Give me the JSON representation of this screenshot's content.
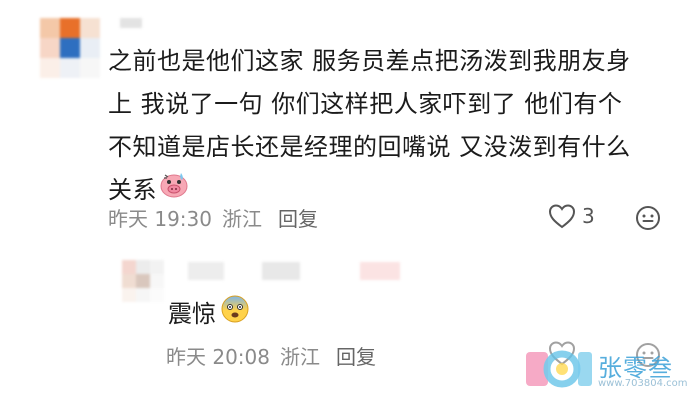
{
  "comment": {
    "text_lines": [
      "之前也是他们这家 服务员差点把汤泼到我朋友身",
      "上 我说了一句 你们这样把人家吓到了 他们有个",
      "不知道是店长还是经理的回嘴说 又没泼到有什么",
      "关系"
    ],
    "emoji": "pig-sweat-emoji",
    "time": "昨天 19:30",
    "location": "浙江",
    "reply_label": "回复",
    "like_count": "3",
    "like_icon": "heart-outline-icon",
    "more_icon": "emoji-face-icon"
  },
  "reply": {
    "text": "震惊",
    "emoji": "shocked-face-emoji",
    "time": "昨天 20:08",
    "location": "浙江",
    "reply_label": "回复"
  },
  "watermark": {
    "name": "张零叁",
    "url": "www.703804.com",
    "logo_colors": [
      "#f38ab0",
      "#62c2e8",
      "#ffd84d"
    ]
  }
}
